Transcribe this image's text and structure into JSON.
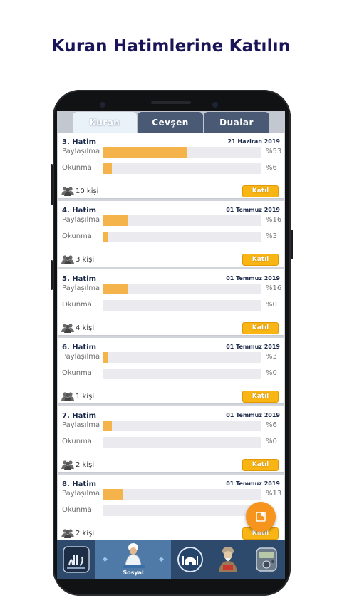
{
  "headline": "Kuran Hatimlerine Katılın",
  "tabs": [
    {
      "label": "Kuran",
      "active": true
    },
    {
      "label": "Cevşen",
      "active": false
    },
    {
      "label": "Dualar",
      "active": false
    }
  ],
  "row_labels": {
    "share": "Paylaşılma",
    "read": "Okunma"
  },
  "join_label": "Katıl",
  "hatims": [
    {
      "title": "3. Hatim",
      "date": "21 Haziran 2019",
      "share_pct": "%53",
      "share": 53,
      "read_pct": "%6",
      "read": 6,
      "people": "10 kişi"
    },
    {
      "title": "4. Hatim",
      "date": "01 Temmuz 2019",
      "share_pct": "%16",
      "share": 16,
      "read_pct": "%3",
      "read": 3,
      "people": "3 kişi"
    },
    {
      "title": "5. Hatim",
      "date": "01 Temmuz 2019",
      "share_pct": "%16",
      "share": 16,
      "read_pct": "%0",
      "read": 0,
      "people": "4 kişi"
    },
    {
      "title": "6. Hatim",
      "date": "01 Temmuz 2019",
      "share_pct": "%3",
      "share": 3,
      "read_pct": "%0",
      "read": 0,
      "people": "1 kişi"
    },
    {
      "title": "7. Hatim",
      "date": "01 Temmuz 2019",
      "share_pct": "%6",
      "share": 6,
      "read_pct": "%0",
      "read": 0,
      "people": "2 kişi"
    },
    {
      "title": "8. Hatim",
      "date": "01 Temmuz 2019",
      "share_pct": "%13",
      "share": 13,
      "read_pct": "",
      "read": 0,
      "people": "2 kişi"
    }
  ],
  "bottom_nav": {
    "selected_label": "Sosyal",
    "items": [
      "allah-calligraphy-icon",
      "praying-man-icon",
      "mosque-icon",
      "elderly-reader-icon",
      "tasbih-counter-icon"
    ]
  },
  "colors": {
    "bar": "#f5b44b",
    "button": "#f8b514",
    "fab": "#f7941d",
    "nav": "#2d4a6c",
    "nav_selected": "#4f79a6",
    "headline": "#1a1558"
  }
}
